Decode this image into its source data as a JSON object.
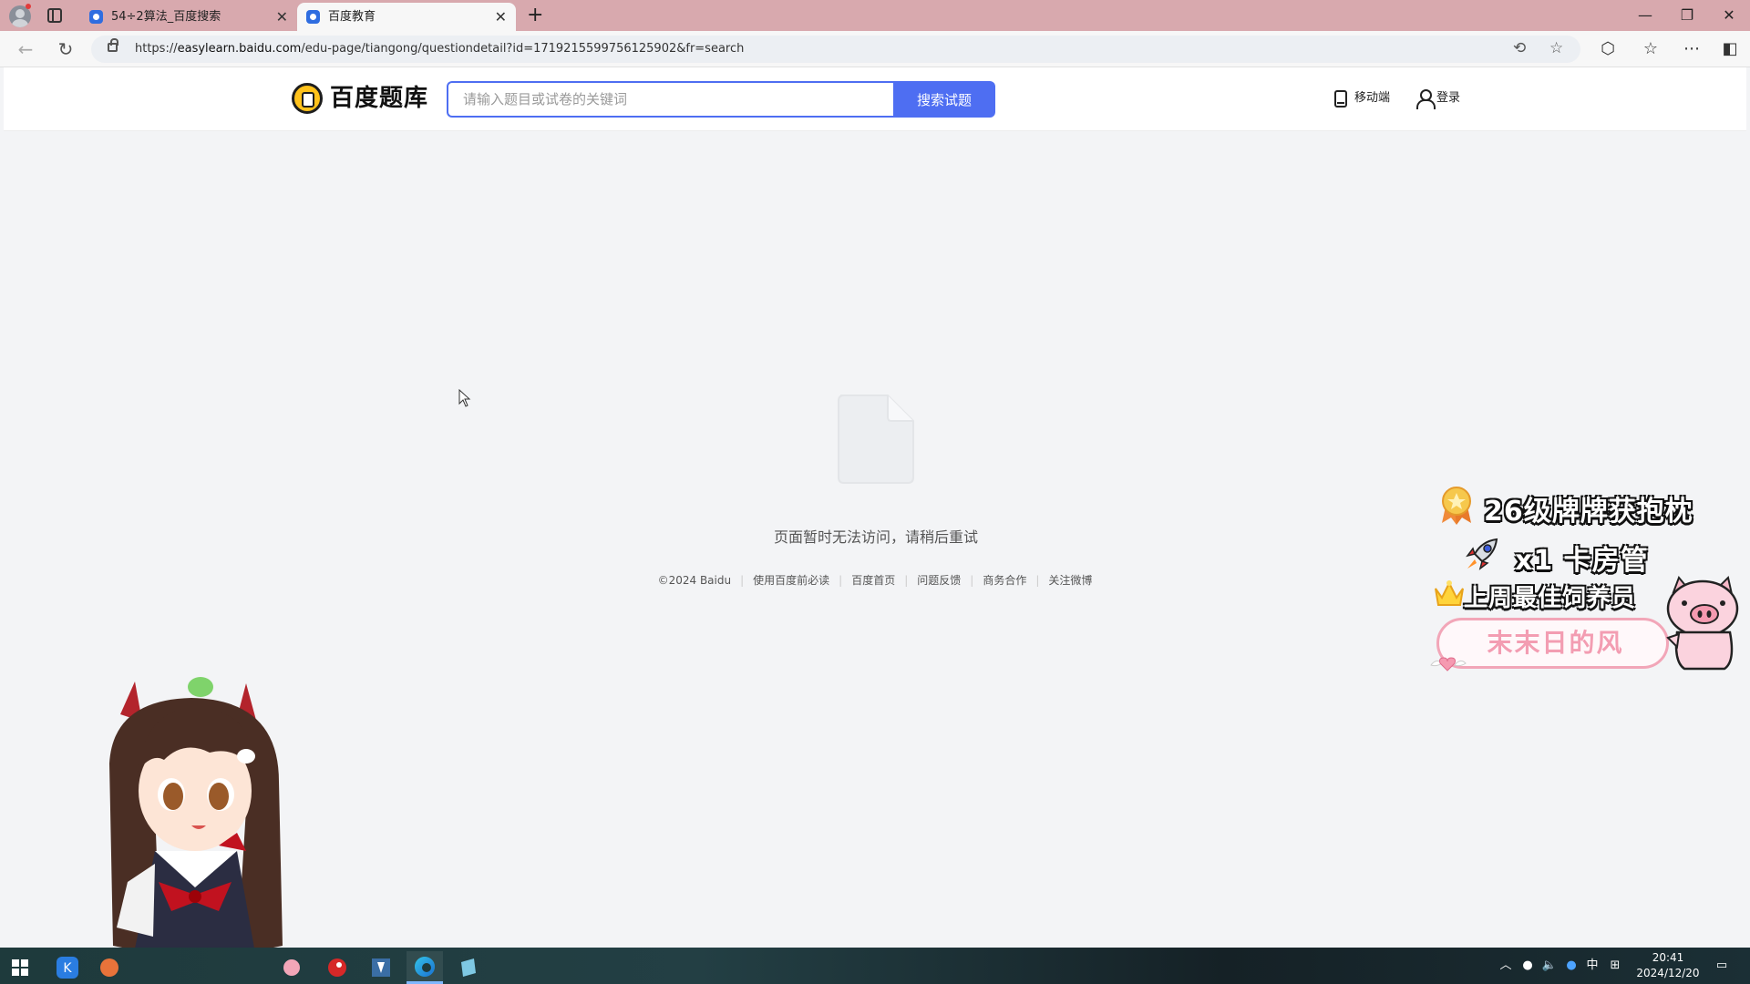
{
  "browser": {
    "tabs": [
      {
        "title": "54÷2算法_百度搜索",
        "active": false
      },
      {
        "title": "百度教育",
        "active": true
      }
    ],
    "new_tab_symbol": "+",
    "url_prefix": "https://",
    "url_domain": "easylearn.baidu.com",
    "url_path": "/edu-page/tiangong/questiondetail?id=1719215599756125902&fr=search",
    "window_controls": [
      "minimize",
      "restore",
      "close"
    ]
  },
  "header": {
    "logo_text": "百度题库",
    "search_placeholder": "请输入题目或试卷的关键词",
    "search_button": "搜索试题",
    "mobile_link": "移动端",
    "login_link": "登录"
  },
  "main": {
    "empty_icon": "document-icon",
    "message": "页面暂时无法访问，请稍后重试"
  },
  "footer": {
    "links": [
      "©2024 Baidu",
      "使用百度前必读",
      "百度首页",
      "问题反馈",
      "商务合作",
      "关注微博"
    ]
  },
  "overlay": {
    "line1": "26级牌牌获抱枕",
    "line2": "x1 卡房管",
    "line3": "上周最佳饲养员",
    "name": "末末日的风"
  },
  "taskbar": {
    "ime": "中",
    "time": "20:41",
    "date": "2024/12/20"
  },
  "colors": {
    "accent": "#4e6ef2",
    "tabbar": "#d8a9ae",
    "page_bg": "#f3f4f6"
  }
}
